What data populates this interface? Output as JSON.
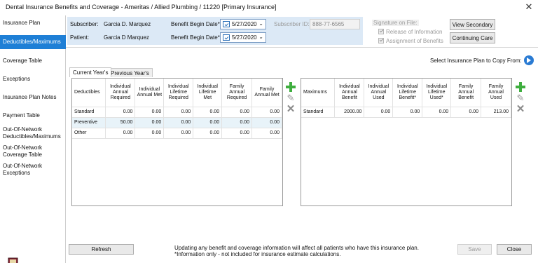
{
  "window": {
    "title": "Dental Insurance Benefits and Coverage - Ameritas / Allied Plumbing / 11220 [Primary Insurance]"
  },
  "nav": {
    "items": [
      {
        "label": "Insurance Plan"
      },
      {
        "label": "Deductibles/Maximums"
      },
      {
        "label": "Coverage Table"
      },
      {
        "label": "Exceptions"
      },
      {
        "label": "Insurance Plan Notes"
      },
      {
        "label": "Payment Table"
      },
      {
        "label": "Out-Of-Network Deductibles/Maximums"
      },
      {
        "label": "Out-Of-Network Coverage Table"
      },
      {
        "label": "Out-Of-Network Exceptions"
      }
    ],
    "active_index": 1
  },
  "header": {
    "subscriber_label": "Subscriber:",
    "subscriber_name": "Garcia D. Marquez",
    "patient_label": "Patient:",
    "patient_name": "Garcia D Marquez",
    "benefit_begin_label": "Benefit Begin Date*",
    "subscriber_begin_date": "5/27/2020",
    "patient_begin_date": "5/27/2020",
    "subscriber_id_label": "Subscriber ID:",
    "subscriber_id": "888-77-6565",
    "signature_label": "Signature on File:",
    "release_label": "Release of Information",
    "assignment_label": "Assignment of Benefits",
    "view_secondary": "View Secondary",
    "continuing_care": "Continuing Care"
  },
  "copy_from": {
    "label": "Select Insurance Plan to Copy From:"
  },
  "tabs": [
    {
      "label": "Current Year's"
    },
    {
      "label": "Previous Year's"
    }
  ],
  "deductibles": {
    "headers": [
      "Deductibles",
      "Individual Annual Required",
      "Individual Annual Met",
      "Individual Lifetime Required",
      "Individual Lifetime Met",
      "Family Annual Required",
      "Family Annual Met"
    ],
    "rows": [
      {
        "label": "Standard",
        "values": [
          "0.00",
          "0.00",
          "0.00",
          "0.00",
          "0.00",
          "0.00"
        ]
      },
      {
        "label": "Preventive",
        "values": [
          "50.00",
          "0.00",
          "0.00",
          "0.00",
          "0.00",
          "0.00"
        ]
      },
      {
        "label": "Other",
        "values": [
          "0.00",
          "0.00",
          "0.00",
          "0.00",
          "0.00",
          "0.00"
        ]
      }
    ],
    "selected_row": 1
  },
  "maximums": {
    "headers": [
      "Maximums",
      "Individual Annual Benefit",
      "Individual Annual Used",
      "Individual Lifetime Benefit*",
      "Individual Lifetime Used*",
      "Family Annual Benefit",
      "Family Annual Used"
    ],
    "rows": [
      {
        "label": "Standard",
        "values": [
          "2000.00",
          "0.00",
          "0.00",
          "0.00",
          "0.00",
          "213.00"
        ]
      }
    ]
  },
  "footer": {
    "refresh": "Refresh",
    "note_line1": "Updating any benefit and coverage information will affect all patients who have this insurance plan.",
    "note_line2": "*Information only - not included for insurance estimate calculations.",
    "save": "Save",
    "close": "Close"
  },
  "colors": {
    "accent": "#1e7fd6",
    "header_band": "#dce9f6",
    "add_green": "#3fae3f"
  }
}
